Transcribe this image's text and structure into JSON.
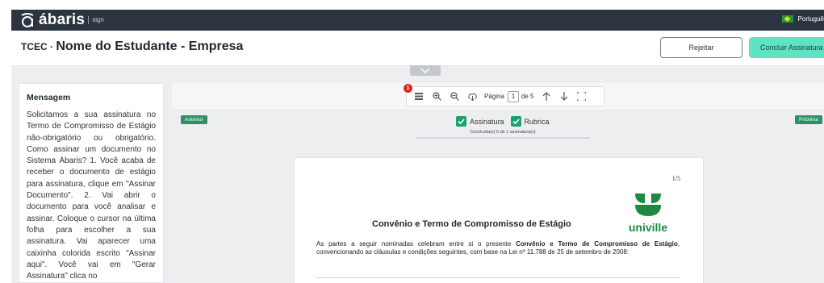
{
  "topbar": {
    "brand": "ábaris",
    "brand_suffix": "sign",
    "language": "Portuguê"
  },
  "header": {
    "prefix": "TCEC",
    "separator": " · ",
    "title": "Nome do Estudante - Empresa",
    "reject_label": "Rejeitar",
    "conclude_label": "Concluir Assinatura"
  },
  "message": {
    "title": "Mensagem",
    "body": "Solicitamos a sua assinatura no Termo de Compromisso de Estágio não-obrigatório ou obrigatório. Como assinar um documento no Sistema Ábaris? 1. Você acaba de receber o documento de estágio para assinatura, clique em \"Assinar Documento\". 2. Vai abrir o documento para você analisar e assinar. Coloque o cursor na última folha para escolher a sua assinatura. Vai aparecer uma caixinha colorida escrito \"Assinar aqui\". Você vai em \"Gerar Assinatura\" clica no"
  },
  "toolbar": {
    "badge_count": "1",
    "page_label": "Página",
    "current_page": "1",
    "page_total": "de 5"
  },
  "navigation": {
    "prev_label": "Anterior",
    "next_label": "Próxima",
    "signature_label": "Assinatura",
    "initials_label": "Rubrica",
    "progress_text": "Concluída(s) 0 de 1 assinatura(s)",
    "progress_fraction": 0
  },
  "document": {
    "page_indicator": "1/5",
    "heading": "Convênio e Termo de Compromisso de Estágio",
    "logo_text": "univille",
    "para_start": "As partes a seguir nominadas celebram entre si o presente ",
    "para_bold": "Convênio e Termo de Compromisso de Estágio",
    "para_end": ", convencionando as cláusulas e condições seguintes, com base na Lei nº 11.788 de 25 de setembro de 2008:"
  },
  "colors": {
    "topbar": "#2b3440",
    "accent": "#5fe3c2",
    "nav_button": "#2f8f65",
    "check": "#1aa36a",
    "badge": "#e0251b",
    "univille_green": "#1d8a43"
  },
  "icons": [
    "abaris-logo-icon",
    "brazil-flag-icon",
    "chevron-down-icon",
    "list-icon",
    "zoom-in-icon",
    "zoom-out-icon",
    "download-icon",
    "arrow-up-icon",
    "arrow-down-icon",
    "fullscreen-icon",
    "check-icon"
  ]
}
